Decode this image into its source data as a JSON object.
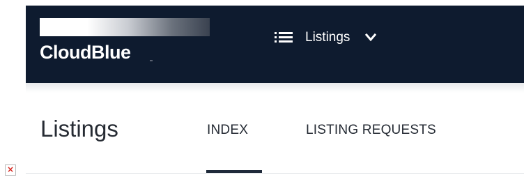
{
  "brand": {
    "name": "CloudBlue",
    "logo_colors": [
      "#ffffff",
      "#3a4250"
    ]
  },
  "navbar": {
    "background": "#0e1b2f",
    "menu_label": "Listings",
    "menu_icon": "hamburger-icon",
    "dropdown_icon": "chevron-down-icon"
  },
  "page": {
    "title": "Listings"
  },
  "tabs": [
    {
      "label": "INDEX",
      "active": true
    },
    {
      "label": "LISTING REQUESTS",
      "active": false
    }
  ],
  "broken_image": {
    "icon": "broken-image-icon",
    "glyph": "×",
    "color": "#d6261f"
  }
}
